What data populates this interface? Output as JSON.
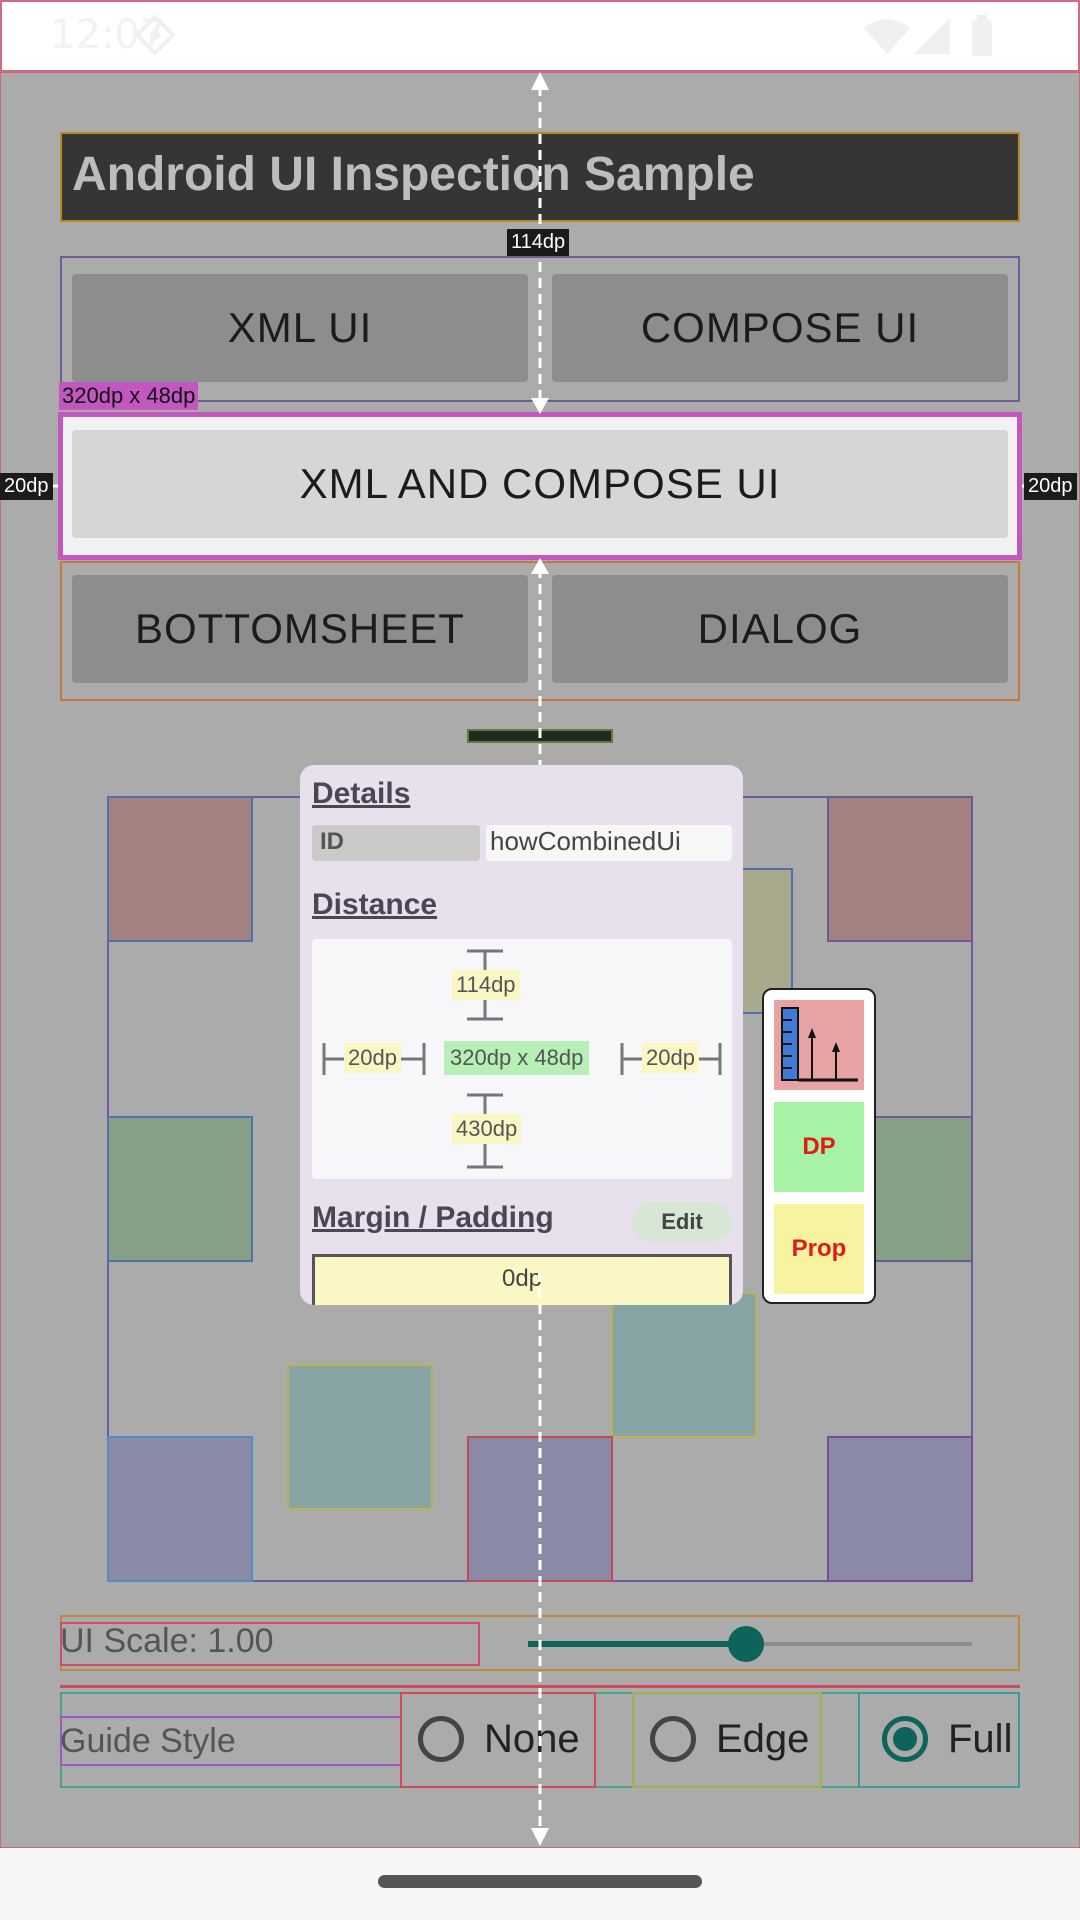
{
  "status_bar": {
    "time": "12:07"
  },
  "app": {
    "title": "Android UI Inspection Sample"
  },
  "buttons": {
    "xml_ui": "XML UI",
    "compose_ui": "COMPOSE UI",
    "xml_and_compose_ui": "XML AND COMPOSE UI",
    "bottomsheet": "BOTTOMSHEET",
    "dialog": "DIALOG"
  },
  "overlay": {
    "top_distance": "114dp",
    "selected_size": "320dp x 48dp",
    "left_margin": "20dp",
    "right_margin": "20dp"
  },
  "details_panel": {
    "details_title": "Details",
    "id_label": "ID",
    "id_value": "howCombinedUi",
    "distance_title": "Distance",
    "distance_top": "114dp",
    "distance_left": "20dp",
    "size": "320dp x 48dp",
    "distance_right": "20dp",
    "distance_bottom": "430dp",
    "margin_padding_title": "Margin / Padding",
    "edit_button": "Edit",
    "margin_value": "0dp"
  },
  "toolbox": {
    "items": [
      {
        "label": "",
        "icon": "ruler-chart-icon",
        "color": "#e7a3a3"
      },
      {
        "label": "DP",
        "color": "#a6f3a6"
      },
      {
        "label": "Prop",
        "color": "#f8f3a0"
      }
    ]
  },
  "ui_scale": {
    "label": "UI Scale: 1.00",
    "value": 1.0,
    "slider_fraction": 0.49
  },
  "guide_style": {
    "label": "Guide Style",
    "options": [
      {
        "label": "None",
        "selected": false
      },
      {
        "label": "Edge",
        "selected": false
      },
      {
        "label": "Full",
        "selected": true
      }
    ]
  },
  "colors": {
    "accent": "#0d645a",
    "selection": "#c257c0"
  }
}
